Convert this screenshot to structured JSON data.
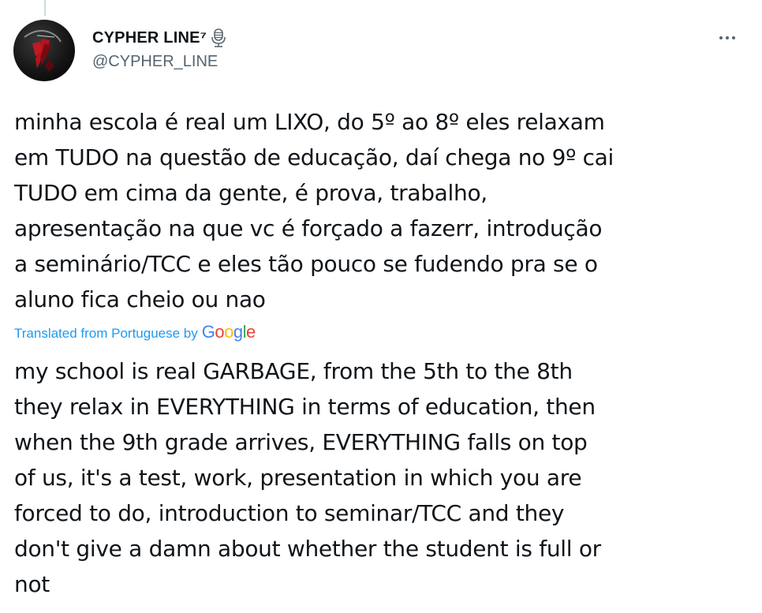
{
  "tweet": {
    "author": {
      "display_name": "CYPHER LINE⁷",
      "handle": "@CYPHER_LINE",
      "badge_icon": "microphone-icon",
      "avatar_icon": "avatar-image"
    },
    "more_icon": "more-dots-icon",
    "original_text": "minha escola é real um LIXO, do 5º ao 8º eles relaxam\nem TUDO na questão de educação, daí chega no 9º cai\nTUDO em cima da gente, é prova, trabalho,\napresentação na que vc é forçado a fazerr, introdução\na seminário/TCC e eles tão pouco se fudendo pra se o\naluno fica cheio ou nao",
    "translation_label": "Translated from Portuguese by",
    "translation_provider": {
      "letters": [
        "G",
        "o",
        "o",
        "g",
        "l",
        "e"
      ]
    },
    "translated_text": "my school is real GARBAGE, from the 5th to the 8th\nthey relax in EVERYTHING in terms of education, then\nwhen the 9th grade arrives, EVERYTHING falls on top\nof us, it's a test, work, presentation in which you are\nforced to do, introduction to seminar/TCC and they\ndon't give a damn about whether the student is full or\nnot"
  },
  "colors": {
    "text": "#0f1419",
    "secondary": "#536471",
    "link": "#1d9bf0"
  }
}
